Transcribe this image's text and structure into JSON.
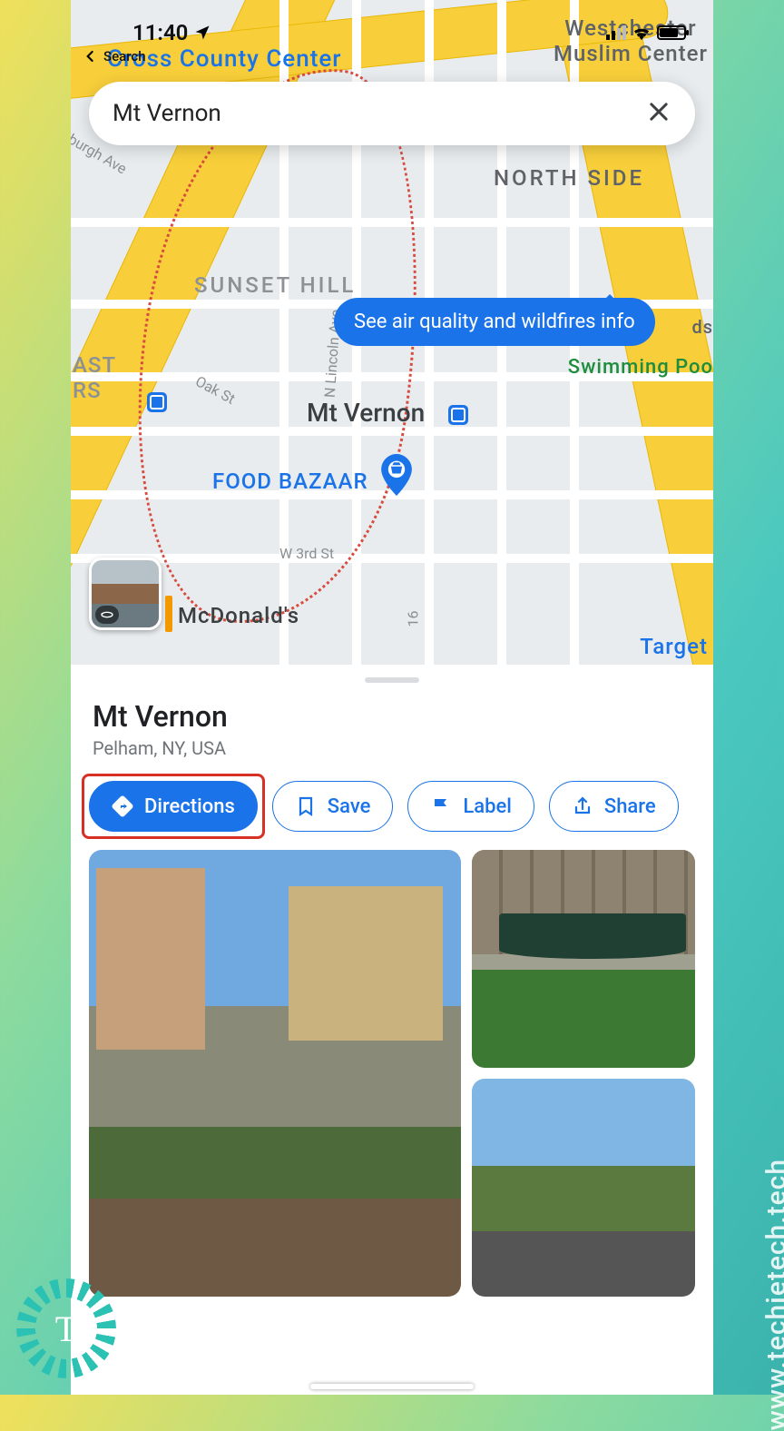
{
  "status": {
    "time": "11:40"
  },
  "back_label": "Search",
  "search": {
    "query": "Mt Vernon"
  },
  "tooltip": "See air quality and wildfires info",
  "map": {
    "center_name": "Mt Vernon",
    "labels": {
      "cross_county": "Cross County Center",
      "westchester_muslim": "Westchester\nMuslim Center",
      "north_side": "NORTH SIDE",
      "sunset_hill": "SUNSET HILL",
      "east_rs_1": "AST",
      "east_rs_2": "RS",
      "swimming_pool": "Swimming Poo",
      "food_bazaar": "FOOD BAZAAR",
      "mcdonalds": "McDonald's",
      "target": "Target",
      "w3rd": "W 3rd St",
      "oak": "Oak St",
      "lincoln": "N Lincoln Ave",
      "burgh": "burgh Ave",
      "s16": "16",
      "ds": "ds"
    }
  },
  "sheet": {
    "title": "Mt Vernon",
    "subtitle": "Pelham, NY, USA",
    "actions": {
      "directions": "Directions",
      "save": "Save",
      "label": "Label",
      "share": "Share"
    }
  },
  "watermark": "www.techietech.tech",
  "badge_letter": "T"
}
